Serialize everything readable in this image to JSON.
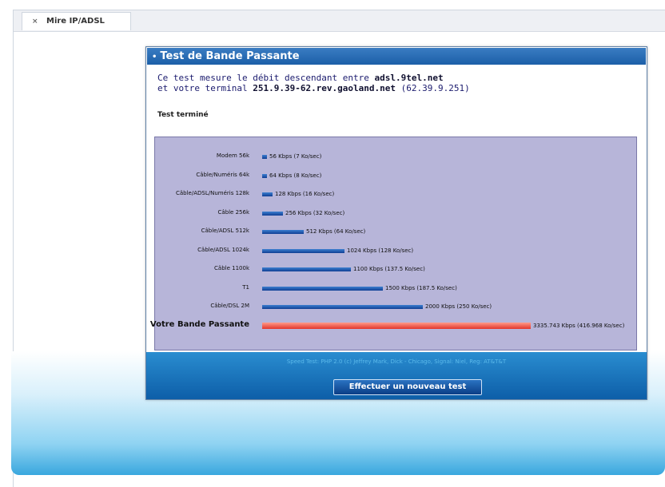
{
  "tab": {
    "close_glyph": "×",
    "label": "Mire IP/ADSL"
  },
  "dialog": {
    "bullet": "•",
    "title": "Test de Bande Passante",
    "desc_line1_prefix": "Ce test mesure le débit descendant entre ",
    "desc_host": "adsl.9tel.net",
    "desc_line2_prefix": "et votre terminal ",
    "desc_terminal": "251.9.39-62.rev.gaoland.net",
    "desc_ip": "(62.39.9.251)",
    "status": "Test terminé",
    "foot_note": "Speed Test: PHP 2.0 (c) Jeffrey Mark, Dick - Chicago, Signal: Niel, Reg: AT&T&T",
    "button": "Effectuer un nouveau test"
  },
  "chart_data": {
    "type": "bar",
    "orientation": "horizontal",
    "unit": "Kbps",
    "rows": [
      {
        "category": "Modem 56k",
        "value": 56,
        "label": "56 Kbps (7 Ko/sec)"
      },
      {
        "category": "Câble/Numéris 64k",
        "value": 64,
        "label": "64 Kbps (8 Ko/sec)"
      },
      {
        "category": "Câble/ADSL/Numéris 128k",
        "value": 128,
        "label": "128 Kbps (16 Ko/sec)"
      },
      {
        "category": "Câble 256k",
        "value": 256,
        "label": "256 Kbps (32 Ko/sec)"
      },
      {
        "category": "Câble/ADSL 512k",
        "value": 512,
        "label": "512 Kbps (64 Ko/sec)"
      },
      {
        "category": "Câble/ADSL 1024k",
        "value": 1024,
        "label": "1024 Kbps (128 Ko/sec)"
      },
      {
        "category": "Câble 1100k",
        "value": 1100,
        "label": "1100 Kbps (137.5 Ko/sec)"
      },
      {
        "category": "T1",
        "value": 1500,
        "label": "1500 Kbps (187.5 Ko/sec)"
      },
      {
        "category": "Câble/DSL 2M",
        "value": 2000,
        "label": "2000 Kbps (250 Ko/sec)"
      },
      {
        "category": "Votre Bande Passante",
        "value": 3335.743,
        "label": "3335.743 Kbps (416.968 Ko/sec)",
        "highlight": true
      }
    ],
    "colors": {
      "bar": "#1c4fa6",
      "highlight": "#e8473a",
      "background": "#b7b5d9"
    }
  }
}
